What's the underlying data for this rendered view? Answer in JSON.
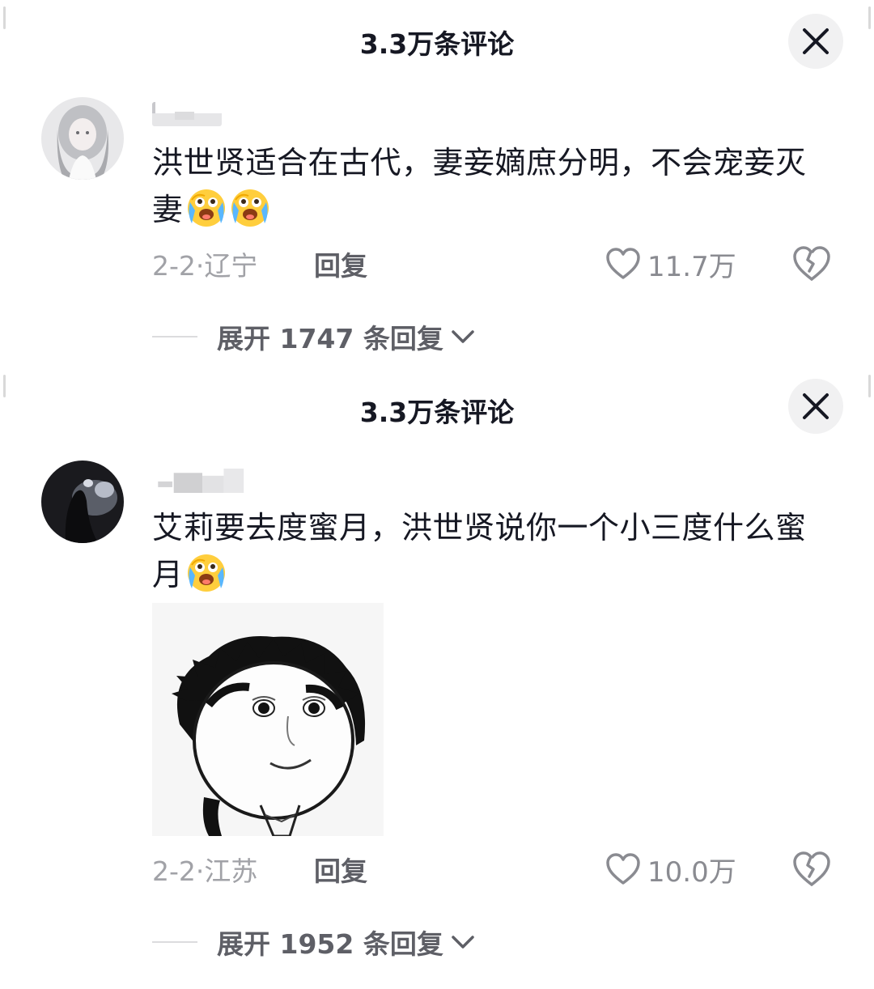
{
  "panels": [
    {
      "header": {
        "title": "3.3万条评论"
      },
      "comment": {
        "text": "洪世贤适合在古代，妻妾嫡庶分明，不会宠妾灭妻",
        "date_location": "2-2·辽宁",
        "reply_label": "回复",
        "like_count": "11.7万",
        "expand_label": "展开 1747 条回复"
      }
    },
    {
      "header": {
        "title": "3.3万条评论"
      },
      "comment": {
        "text": "艾莉要去度蜜月，洪世贤说你一个小三度什么蜜月",
        "date_location": "2-2·江苏",
        "reply_label": "回复",
        "like_count": "10.0万",
        "expand_label": "展开 1952 条回复"
      }
    }
  ],
  "icons": {
    "close": "close-icon",
    "emoji": "crying-laughing-emoji-icon",
    "like": "heart-outline-icon",
    "dislike": "broken-heart-icon",
    "expand": "chevron-down-icon"
  },
  "colors": {
    "text_primary": "#161823",
    "text_secondary": "#a1a2a7",
    "close_bg": "#f1f1f2"
  }
}
